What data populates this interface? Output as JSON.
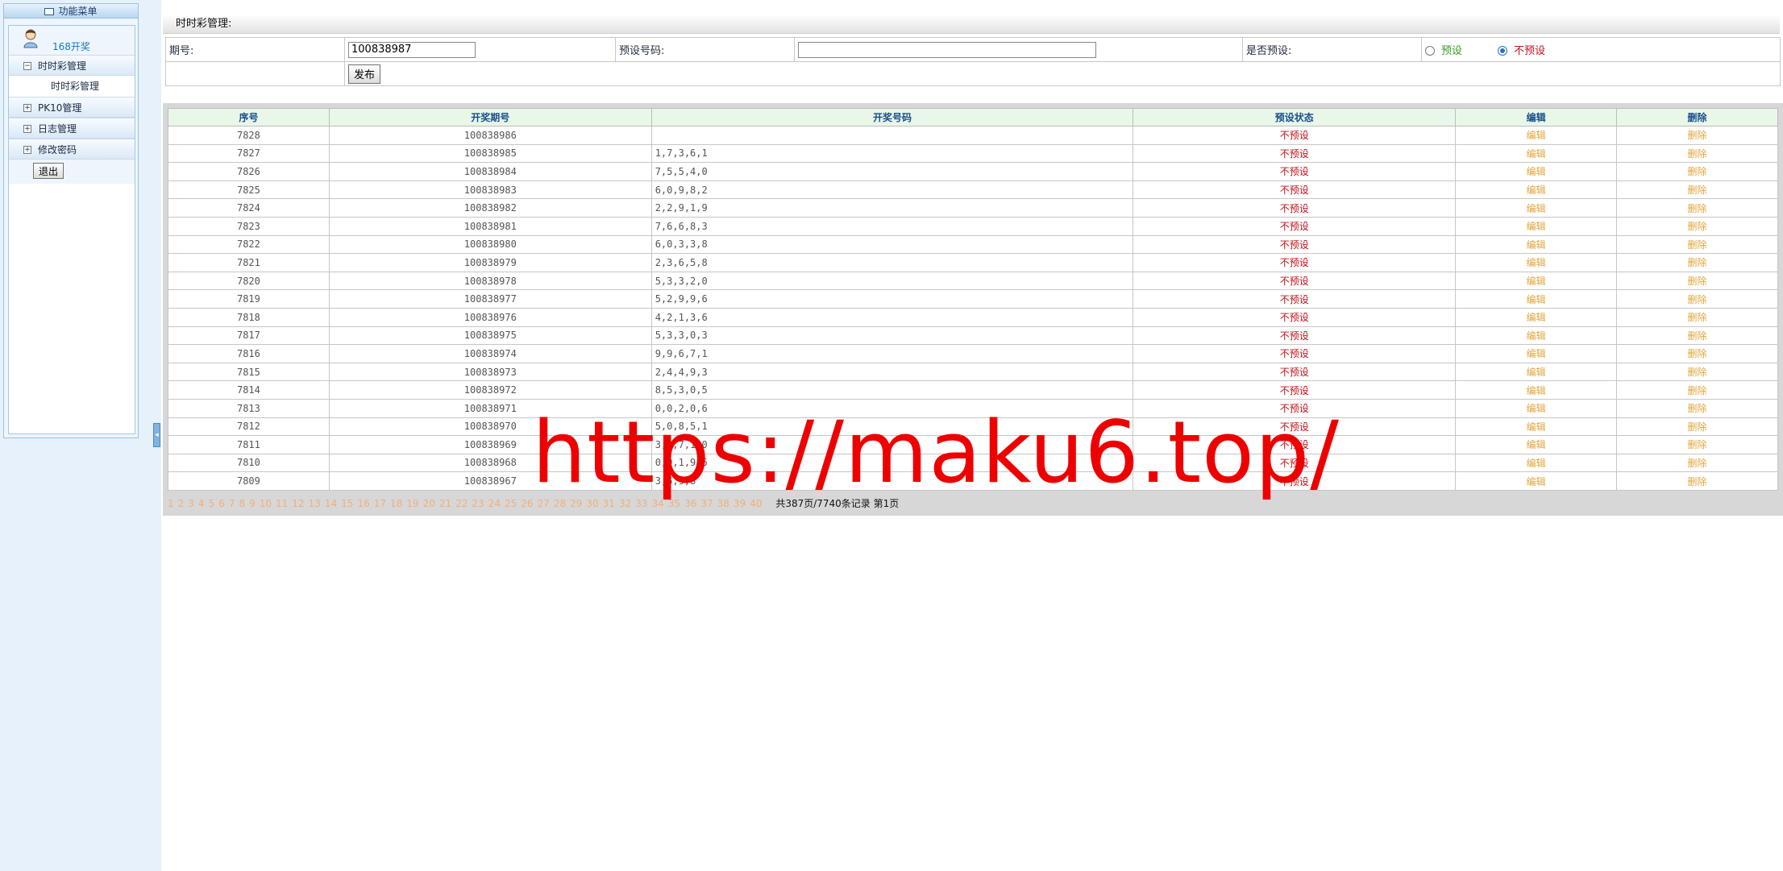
{
  "sidebar": {
    "header_title": "功能菜单",
    "user_title": "168开奖",
    "groups": [
      {
        "label": "时时彩管理",
        "toggle": "−"
      },
      {
        "label": "PK10管理",
        "toggle": "+"
      },
      {
        "label": "日志管理",
        "toggle": "+"
      },
      {
        "label": "修改密码",
        "toggle": "+"
      }
    ],
    "sub_item": "时时彩管理",
    "logout_label": "退出",
    "collapse_glyph": "◂"
  },
  "page": {
    "title": "时时彩管理:"
  },
  "form": {
    "issue_label": "期号:",
    "issue_value": "100838987",
    "preset_code_label": "预设号码:",
    "preset_code_value": "",
    "is_preset_label": "是否预设:",
    "option_yes": "预设",
    "option_no": "不预设",
    "selected_option": "不预设",
    "publish_label": "发布"
  },
  "table": {
    "columns": [
      "序号",
      "开奖期号",
      "开奖号码",
      "预设状态",
      "编辑",
      "删除"
    ],
    "rows": [
      {
        "id": "7828",
        "issue": "100838986",
        "code": "",
        "status": "不预设",
        "edit": "编辑",
        "del": "删除"
      },
      {
        "id": "7827",
        "issue": "100838985",
        "code": "1,7,3,6,1",
        "status": "不预设",
        "edit": "编辑",
        "del": "删除"
      },
      {
        "id": "7826",
        "issue": "100838984",
        "code": "7,5,5,4,0",
        "status": "不预设",
        "edit": "编辑",
        "del": "删除"
      },
      {
        "id": "7825",
        "issue": "100838983",
        "code": "6,0,9,8,2",
        "status": "不预设",
        "edit": "编辑",
        "del": "删除"
      },
      {
        "id": "7824",
        "issue": "100838982",
        "code": "2,2,9,1,9",
        "status": "不预设",
        "edit": "编辑",
        "del": "删除"
      },
      {
        "id": "7823",
        "issue": "100838981",
        "code": "7,6,6,8,3",
        "status": "不预设",
        "edit": "编辑",
        "del": "删除"
      },
      {
        "id": "7822",
        "issue": "100838980",
        "code": "6,0,3,3,8",
        "status": "不预设",
        "edit": "编辑",
        "del": "删除"
      },
      {
        "id": "7821",
        "issue": "100838979",
        "code": "2,3,6,5,8",
        "status": "不预设",
        "edit": "编辑",
        "del": "删除"
      },
      {
        "id": "7820",
        "issue": "100838978",
        "code": "5,3,3,2,0",
        "status": "不预设",
        "edit": "编辑",
        "del": "删除"
      },
      {
        "id": "7819",
        "issue": "100838977",
        "code": "5,2,9,9,6",
        "status": "不预设",
        "edit": "编辑",
        "del": "删除"
      },
      {
        "id": "7818",
        "issue": "100838976",
        "code": "4,2,1,3,6",
        "status": "不预设",
        "edit": "编辑",
        "del": "删除"
      },
      {
        "id": "7817",
        "issue": "100838975",
        "code": "5,3,3,0,3",
        "status": "不预设",
        "edit": "编辑",
        "del": "删除"
      },
      {
        "id": "7816",
        "issue": "100838974",
        "code": "9,9,6,7,1",
        "status": "不预设",
        "edit": "编辑",
        "del": "删除"
      },
      {
        "id": "7815",
        "issue": "100838973",
        "code": "2,4,4,9,3",
        "status": "不预设",
        "edit": "编辑",
        "del": "删除"
      },
      {
        "id": "7814",
        "issue": "100838972",
        "code": "8,5,3,0,5",
        "status": "不预设",
        "edit": "编辑",
        "del": "删除"
      },
      {
        "id": "7813",
        "issue": "100838971",
        "code": "0,0,2,0,6",
        "status": "不预设",
        "edit": "编辑",
        "del": "删除"
      },
      {
        "id": "7812",
        "issue": "100838970",
        "code": "5,0,8,5,1",
        "status": "不预设",
        "edit": "编辑",
        "del": "删除"
      },
      {
        "id": "7811",
        "issue": "100838969",
        "code": "3,0,7,1,0",
        "status": "不预设",
        "edit": "编辑",
        "del": "删除"
      },
      {
        "id": "7810",
        "issue": "100838968",
        "code": "0,0,1,9,6",
        "status": "不预设",
        "edit": "编辑",
        "del": "删除"
      },
      {
        "id": "7809",
        "issue": "100838967",
        "code": "3,6,9,8",
        "status": "不预设",
        "edit": "编辑",
        "del": "删除"
      }
    ]
  },
  "pager": {
    "pages": [
      "1",
      "2",
      "3",
      "4",
      "5",
      "6",
      "7",
      "8",
      "9",
      "10",
      "11",
      "12",
      "13",
      "14",
      "15",
      "16",
      "17",
      "18",
      "19",
      "20",
      "21",
      "22",
      "23",
      "24",
      "25",
      "26",
      "27",
      "28",
      "29",
      "30",
      "31",
      "32",
      "33",
      "34",
      "35",
      "36",
      "37",
      "38",
      "39",
      "40"
    ],
    "summary": "共387页/7740条记录 第1页"
  },
  "watermark": "https://maku6.top/"
}
